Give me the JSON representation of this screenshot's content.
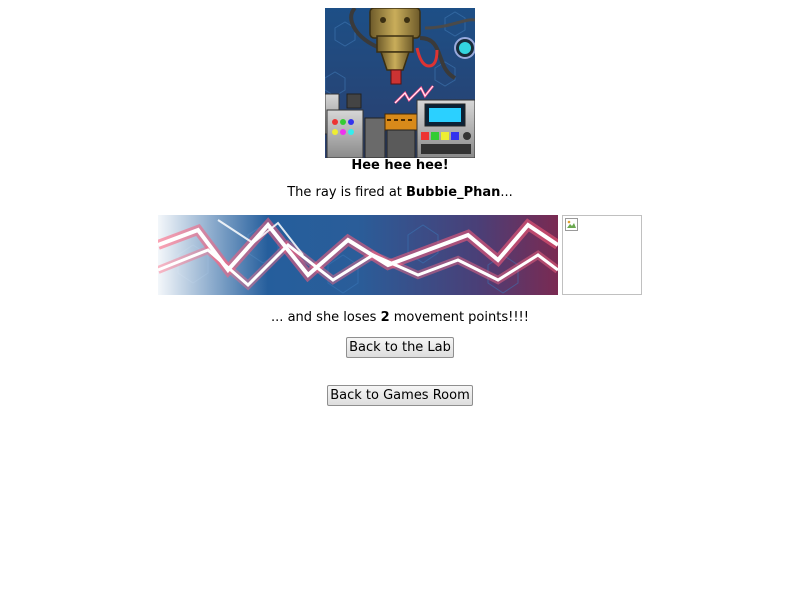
{
  "result": {
    "headline": "Hee hee hee!",
    "fired_prefix": "The ray is fired at ",
    "pet_name": "Bubbie_Phan",
    "fired_suffix": "...",
    "loss_prefix": "... and she loses ",
    "loss_amount": "2",
    "loss_suffix": " movement points!!!!"
  },
  "buttons": {
    "back_to_lab": "Back to the Lab",
    "back_to_games": "Back to Games Room"
  },
  "icons": {
    "pet_image": "broken-image-icon"
  }
}
